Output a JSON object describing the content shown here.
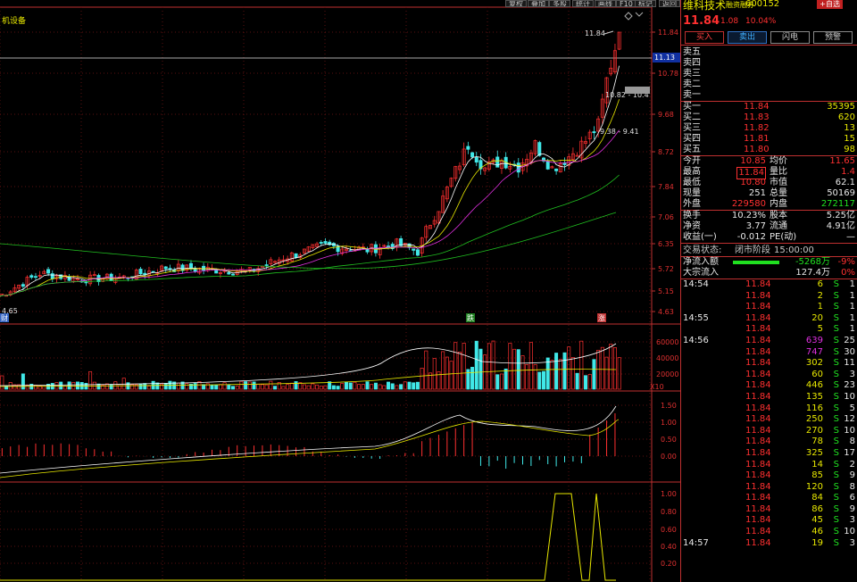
{
  "toolbar": [
    "复权",
    "叠加",
    "多股",
    "统计",
    "画线",
    "F10",
    "标记",
    "返回"
  ],
  "chart_data": [
    {
      "type": "candlestick",
      "ylim": [
        4.63,
        11.84
      ],
      "ticks": [
        "11.84",
        "10.78",
        "9.68",
        "8.72",
        "7.84",
        "7.06",
        "6.35",
        "5.72",
        "5.15",
        "4.63"
      ],
      "annotations": [
        "11.84",
        "10.82 - 10.4",
        "9.38 - 9.41",
        "4.65",
        "11.13"
      ],
      "markers": [
        "财",
        "跌",
        "涨"
      ],
      "legend_text": "机设备"
    },
    {
      "type": "bar",
      "ticks": [
        "60000",
        "40000",
        "20000"
      ],
      "label": "X10"
    },
    {
      "type": "line",
      "ticks": [
        "1.50",
        "1.00",
        "0.50",
        "0.00"
      ]
    },
    {
      "type": "line",
      "ticks": [
        "1.00",
        "0.80",
        "0.60",
        "0.40",
        "0.20"
      ]
    }
  ],
  "stock": {
    "name": "维科技术",
    "badge": "融资融券",
    "code": "600152",
    "add": "+自选",
    "price": "11.84",
    "change": "1.08",
    "pct": "10.04%"
  },
  "buttons": [
    "买入",
    "卖出",
    "闪电",
    "预警"
  ],
  "asks": [
    {
      "l": "卖五",
      "p": "",
      "v": ""
    },
    {
      "l": "卖四",
      "p": "",
      "v": ""
    },
    {
      "l": "卖三",
      "p": "",
      "v": ""
    },
    {
      "l": "卖二",
      "p": "",
      "v": ""
    },
    {
      "l": "卖一",
      "p": "",
      "v": ""
    }
  ],
  "bids": [
    {
      "l": "买一",
      "p": "11.84",
      "v": "35395"
    },
    {
      "l": "买二",
      "p": "11.83",
      "v": "620"
    },
    {
      "l": "买三",
      "p": "11.82",
      "v": "13"
    },
    {
      "l": "买四",
      "p": "11.81",
      "v": "15"
    },
    {
      "l": "买五",
      "p": "11.80",
      "v": "98"
    }
  ],
  "stats": [
    {
      "a": "今开",
      "b": "10.85",
      "c": "均价",
      "d": "11.65",
      "bc": "red",
      "dc": "red"
    },
    {
      "a": "最高",
      "b": "11.84",
      "c": "量比",
      "d": "1.4",
      "bc": "red",
      "dc": "red",
      "box": true
    },
    {
      "a": "最低",
      "b": "10.80",
      "c": "市值",
      "d": "62.1",
      "bc": "red",
      "dc": "wht"
    },
    {
      "a": "现量",
      "b": "251",
      "c": "总量",
      "d": "50169",
      "bc": "wht",
      "dc": "wht"
    },
    {
      "a": "外盘",
      "b": "229580",
      "c": "内盘",
      "d": "272117",
      "bc": "red",
      "dc": "grn"
    }
  ],
  "stats2": [
    {
      "a": "换手",
      "b": "10.23%",
      "c": "股本",
      "d": "5.25亿"
    },
    {
      "a": "净资",
      "b": "3.77",
      "c": "流通",
      "d": "4.91亿"
    },
    {
      "a": "收益(一)",
      "b": "-0.012",
      "c": "PE(动)",
      "d": "—"
    }
  ],
  "status": {
    "label": "交易状态:",
    "v1": "闭市阶段",
    "v2": "15:00:00"
  },
  "flows": [
    {
      "l": "净流入额",
      "v": "-5268万",
      "p": "-9%",
      "vc": "grn",
      "pc": "red"
    },
    {
      "l": "大宗流入",
      "v": "127.4万",
      "p": "0%",
      "vc": "wht",
      "pc": "red"
    }
  ],
  "ticks": [
    {
      "t": "14:54",
      "p": "11.84",
      "v": "6",
      "s": "S",
      "n": "1"
    },
    {
      "t": "",
      "p": "11.84",
      "v": "2",
      "s": "S",
      "n": "1"
    },
    {
      "t": "",
      "p": "11.84",
      "v": "1",
      "s": "S",
      "n": "1"
    },
    {
      "t": "14:55",
      "p": "11.84",
      "v": "20",
      "s": "S",
      "n": "1"
    },
    {
      "t": "",
      "p": "11.84",
      "v": "5",
      "s": "S",
      "n": "1"
    },
    {
      "t": "14:56",
      "p": "11.84",
      "v": "639",
      "s": "S",
      "n": "25",
      "vc": "mag"
    },
    {
      "t": "",
      "p": "11.84",
      "v": "747",
      "s": "S",
      "n": "30",
      "vc": "mag"
    },
    {
      "t": "",
      "p": "11.84",
      "v": "302",
      "s": "S",
      "n": "11"
    },
    {
      "t": "",
      "p": "11.84",
      "v": "60",
      "s": "S",
      "n": "3"
    },
    {
      "t": "",
      "p": "11.84",
      "v": "446",
      "s": "S",
      "n": "23"
    },
    {
      "t": "",
      "p": "11.84",
      "v": "135",
      "s": "S",
      "n": "10"
    },
    {
      "t": "",
      "p": "11.84",
      "v": "116",
      "s": "S",
      "n": "5"
    },
    {
      "t": "",
      "p": "11.84",
      "v": "250",
      "s": "S",
      "n": "12"
    },
    {
      "t": "",
      "p": "11.84",
      "v": "270",
      "s": "S",
      "n": "10"
    },
    {
      "t": "",
      "p": "11.84",
      "v": "78",
      "s": "S",
      "n": "8"
    },
    {
      "t": "",
      "p": "11.84",
      "v": "325",
      "s": "S",
      "n": "17"
    },
    {
      "t": "",
      "p": "11.84",
      "v": "14",
      "s": "S",
      "n": "2"
    },
    {
      "t": "",
      "p": "11.84",
      "v": "85",
      "s": "S",
      "n": "9"
    },
    {
      "t": "",
      "p": "11.84",
      "v": "120",
      "s": "S",
      "n": "8"
    },
    {
      "t": "",
      "p": "11.84",
      "v": "84",
      "s": "S",
      "n": "6"
    },
    {
      "t": "",
      "p": "11.84",
      "v": "86",
      "s": "S",
      "n": "9"
    },
    {
      "t": "",
      "p": "11.84",
      "v": "45",
      "s": "S",
      "n": "3"
    },
    {
      "t": "",
      "p": "11.84",
      "v": "46",
      "s": "S",
      "n": "10"
    },
    {
      "t": "14:57",
      "p": "11.84",
      "v": "19",
      "s": "S",
      "n": "3"
    }
  ]
}
